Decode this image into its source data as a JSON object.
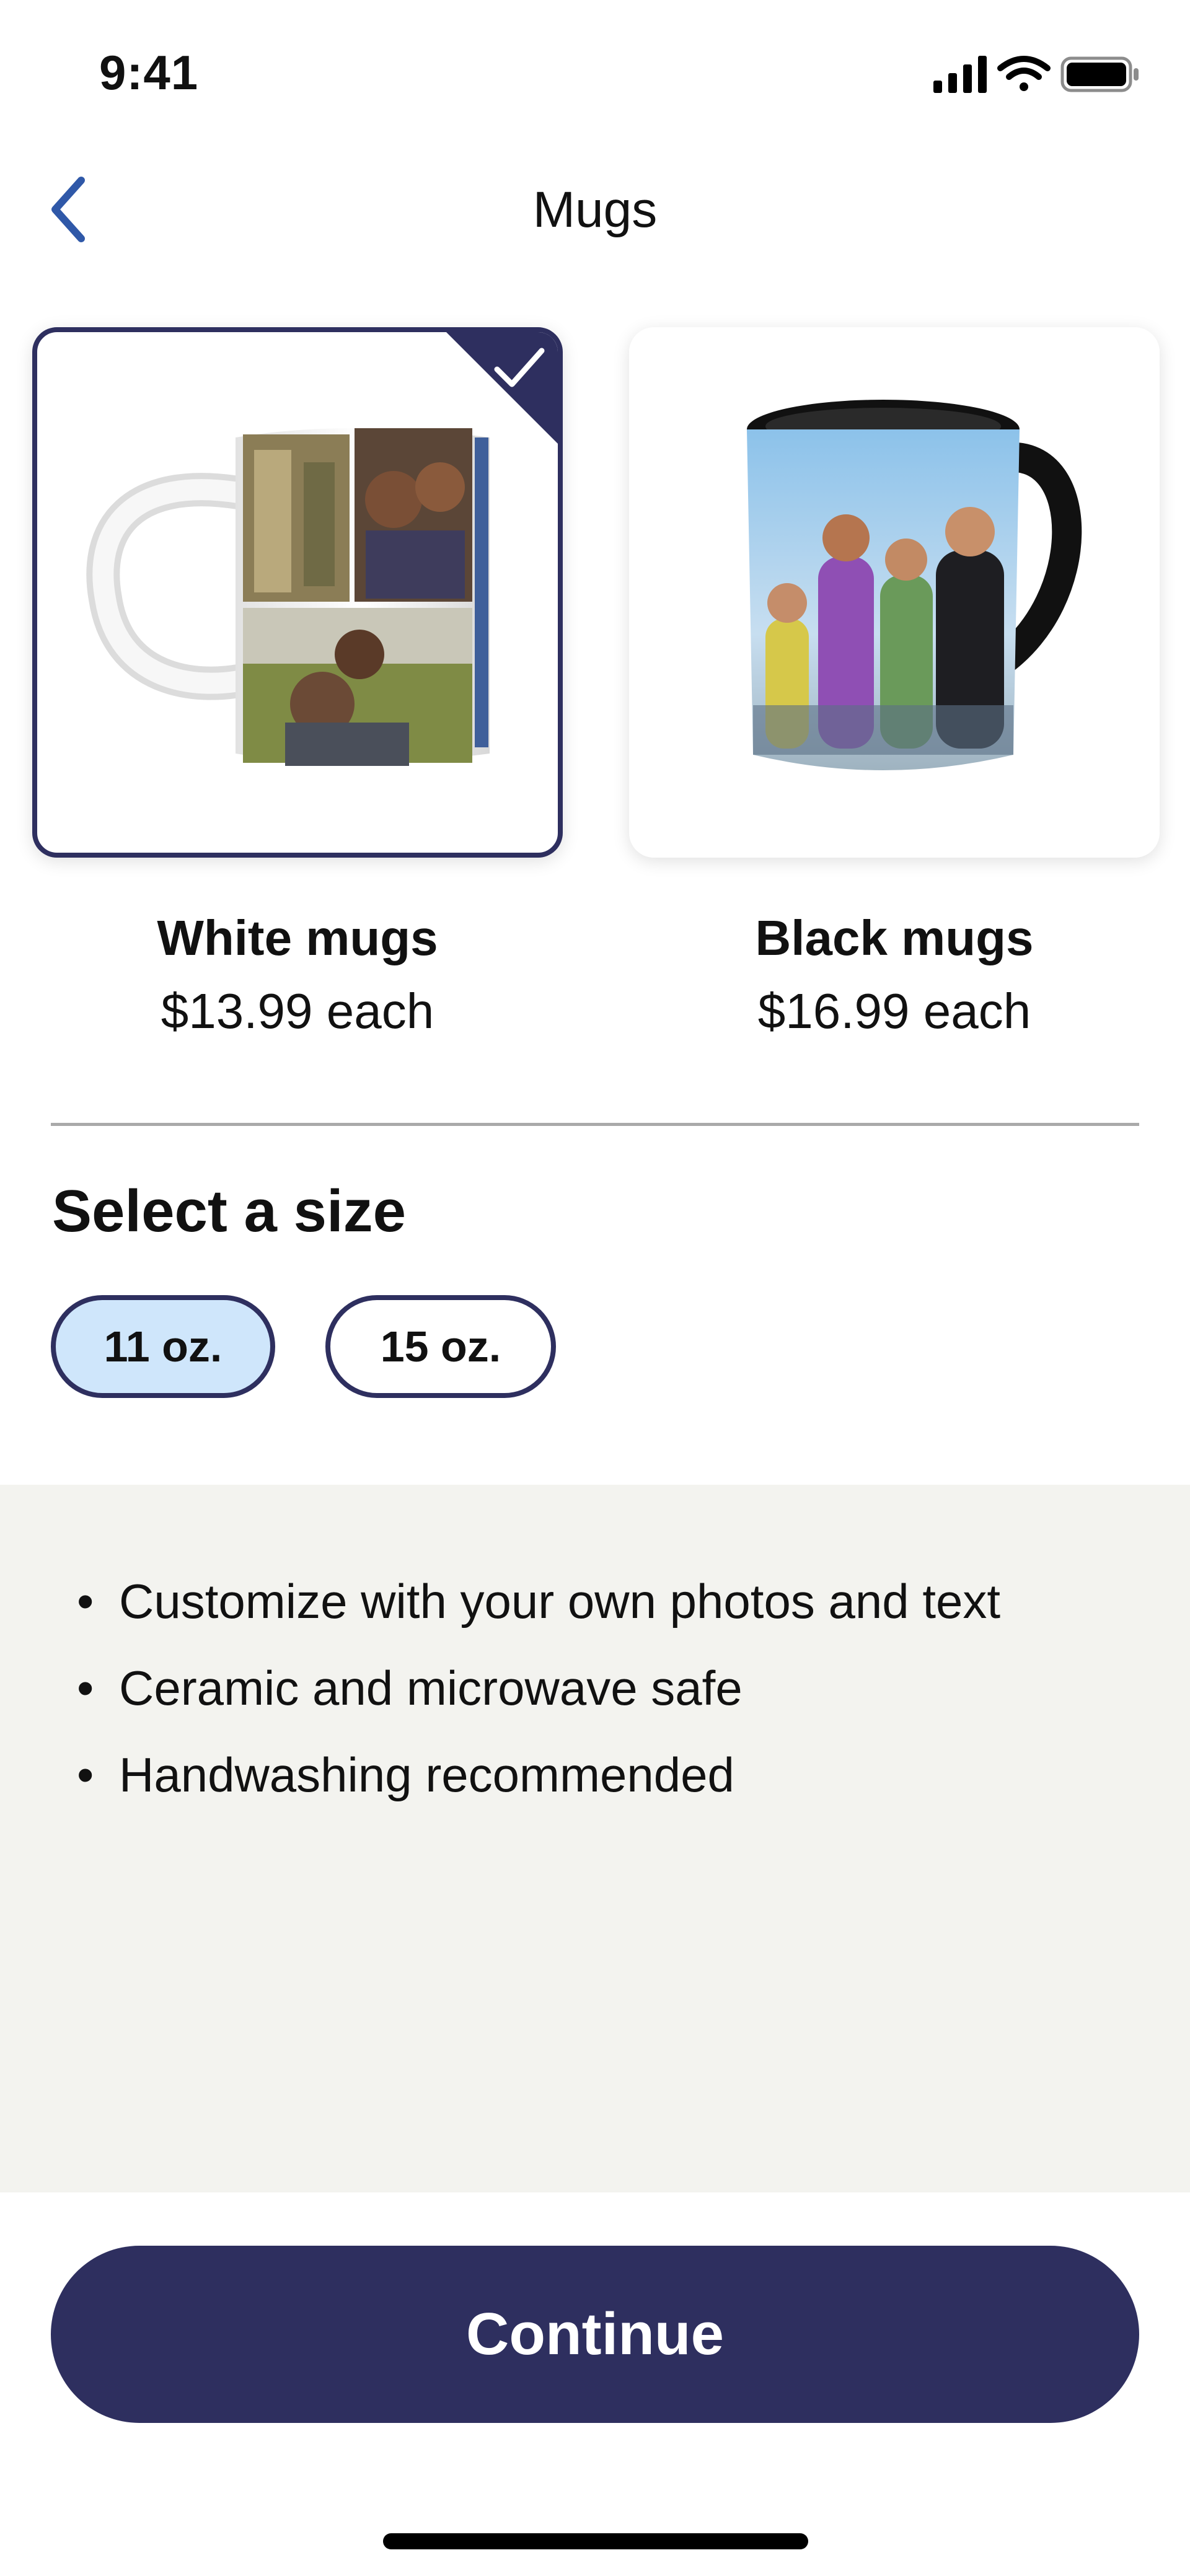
{
  "status_bar": {
    "time": "9:41",
    "icons": [
      "cellular-signal-icon",
      "wifi-icon",
      "battery-icon"
    ]
  },
  "nav": {
    "title": "Mugs",
    "back_icon": "chevron-left-icon"
  },
  "products": [
    {
      "name": "White mugs",
      "price": "$13.99 each",
      "selected": true,
      "image": "white-mug-photo-collage"
    },
    {
      "name": "Black mugs",
      "price": "$16.99 each",
      "selected": false,
      "image": "black-mug-family-photo"
    }
  ],
  "size": {
    "heading": "Select a size",
    "options": [
      {
        "label": "11 oz.",
        "selected": true
      },
      {
        "label": "15 oz.",
        "selected": false
      }
    ]
  },
  "features": [
    "Customize with your own photos and text",
    "Ceramic and microwave safe",
    "Handwashing recommended"
  ],
  "continue_label": "Continue",
  "colors": {
    "accent": "#2e2f5f",
    "selected_pill": "#cfe6fb",
    "back_chevron": "#2f58a8",
    "features_bg": "#f3f3ef"
  }
}
